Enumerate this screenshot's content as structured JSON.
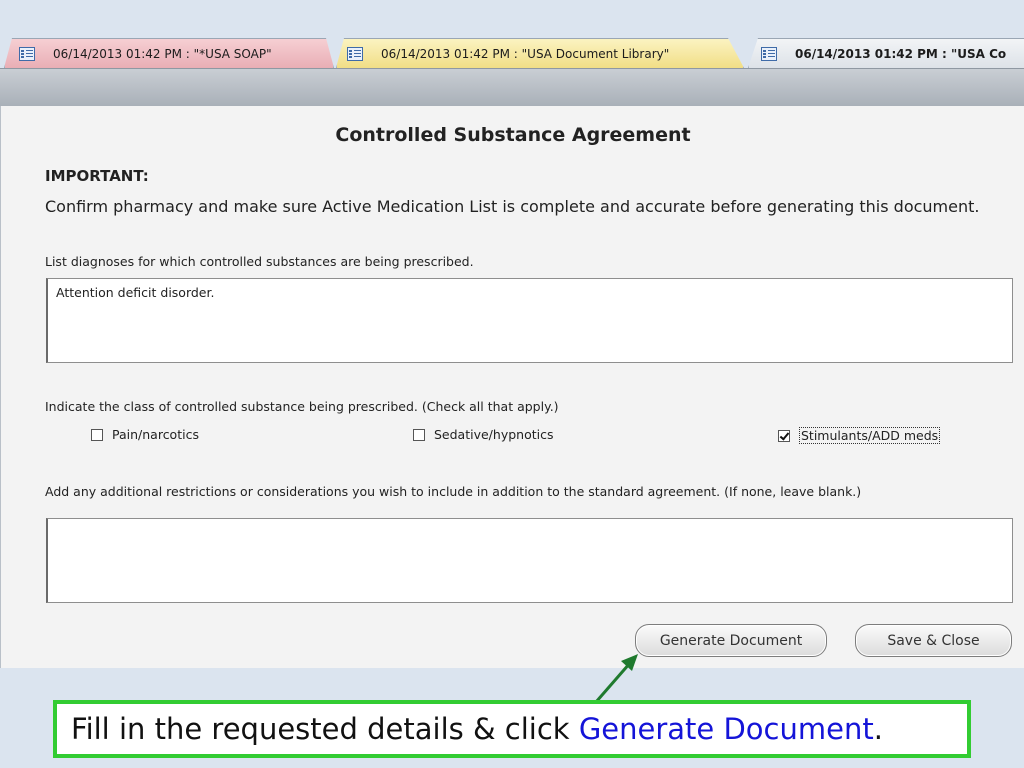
{
  "tabs": [
    {
      "label": "06/14/2013 01:42 PM : \"*USA SOAP\""
    },
    {
      "label": "06/14/2013 01:42 PM : \"USA Document Library\""
    },
    {
      "label": "06/14/2013 01:42 PM : \"USA Co"
    }
  ],
  "form": {
    "title": "Controlled Substance Agreement",
    "important_heading": "IMPORTANT:",
    "important_text": "Confirm pharmacy and make sure Active Medication List is complete and accurate before generating this document.",
    "diagnoses_label": "List diagnoses for which controlled substances are being prescribed.",
    "diagnoses_value": "Attention deficit disorder.",
    "class_label": "Indicate the class of controlled substance being prescribed.  (Check all that apply.)",
    "classes": [
      {
        "label": "Pain/narcotics",
        "checked": false
      },
      {
        "label": "Sedative/hypnotics",
        "checked": false
      },
      {
        "label": "Stimulants/ADD meds",
        "checked": true
      }
    ],
    "restrictions_label": "Add any additional restrictions or considerations you wish to include in addition to the standard agreement.  (If none, leave blank.)",
    "restrictions_value": "",
    "generate_button": "Generate Document",
    "save_button": "Save & Close"
  },
  "callout": {
    "text_before": "Fill in the requested details & click ",
    "highlight": "Generate Document",
    "text_after": "."
  },
  "colors": {
    "callout_border": "#32cc32",
    "callout_highlight": "#1414d8",
    "arrow": "#1f7a2e"
  }
}
